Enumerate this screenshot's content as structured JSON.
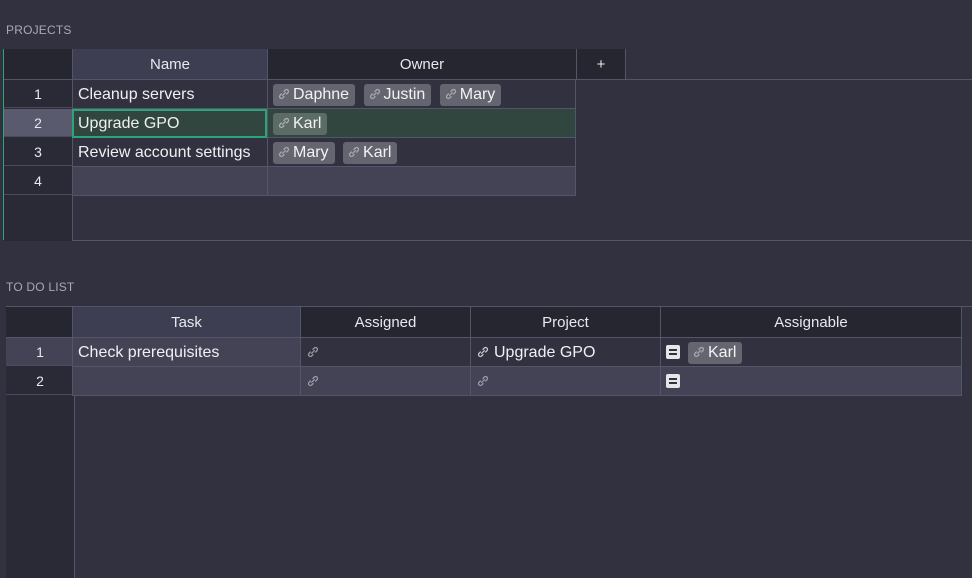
{
  "projects": {
    "title": "PROJECTS",
    "columns": [
      "Name",
      "Owner"
    ],
    "add_column_label": "+",
    "rows": [
      {
        "num": "1",
        "name": "Cleanup servers",
        "owners": [
          "Daphne",
          "Justin",
          "Mary"
        ]
      },
      {
        "num": "2",
        "name": "Upgrade GPO",
        "owners": [
          "Karl"
        ]
      },
      {
        "num": "3",
        "name": "Review account settings",
        "owners": [
          "Mary",
          "Karl"
        ]
      }
    ],
    "add_row_num": "4"
  },
  "todo": {
    "title": "TO DO LIST",
    "columns": [
      "Task",
      "Assigned",
      "Project",
      "Assignable"
    ],
    "rows": [
      {
        "num": "1",
        "task": "Check prerequisites",
        "assigned": "",
        "project": "Upgrade GPO",
        "assignable": [
          "Karl"
        ]
      }
    ],
    "add_row_num": "2"
  },
  "colors": {
    "background": "#31313f",
    "selection_accent": "#2da37a",
    "chip": "#65656f"
  }
}
